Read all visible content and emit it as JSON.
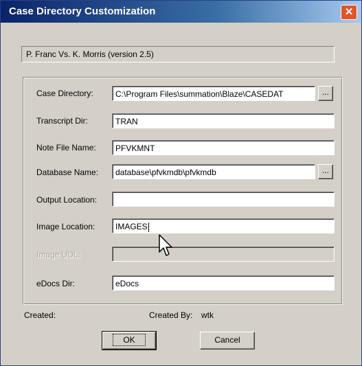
{
  "window": {
    "title": "Case Directory Customization",
    "close_glyph": "✕"
  },
  "case_name": "P. Franc Vs. K. Morris (version 2.5)",
  "fields": {
    "case_directory": {
      "label": "Case Directory:",
      "value": "C:\\Program Files\\summation\\Blaze\\CASEDAT",
      "browse_label": "..."
    },
    "transcript_dir": {
      "label": "Transcript Dir:",
      "value": "TRAN"
    },
    "note_file_name": {
      "label": "Note File Name:",
      "value": "PFVKMNT"
    },
    "database_name": {
      "label": "Database Name:",
      "value": "database\\pfvkmdb\\pfvkmdb",
      "browse_label": "..."
    },
    "output_location": {
      "label": "Output Location:",
      "value": ""
    },
    "image_location": {
      "label": "Image Location:",
      "value": "IMAGES"
    },
    "image_udl": {
      "label": "Image UDL:",
      "value": ""
    },
    "edocs_dir": {
      "label": "eDocs Dir:",
      "value": "eDocs"
    }
  },
  "footer": {
    "created_label": "Created:",
    "created_by_label": "Created By:",
    "created_by_value": "wtk"
  },
  "buttons": {
    "ok": "OK",
    "cancel": "Cancel"
  }
}
